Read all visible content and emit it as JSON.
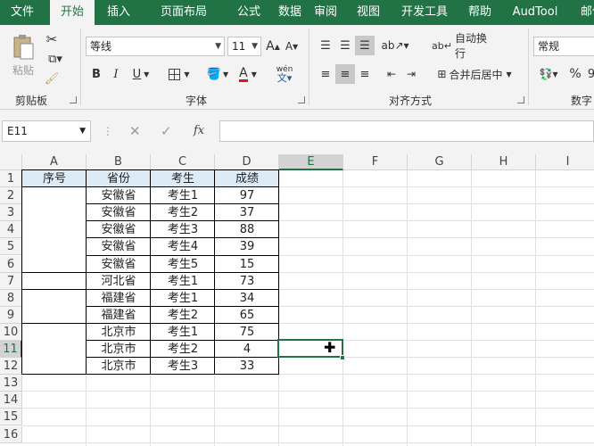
{
  "tabs": [
    "文件",
    "开始",
    "插入",
    "页面布局",
    "公式",
    "数据",
    "审阅",
    "视图",
    "开发工具",
    "帮助",
    "AudTool",
    "邮件"
  ],
  "active_tab": "开始",
  "ribbon": {
    "clipboard": {
      "paste_label": "粘贴",
      "group_label": "剪贴板"
    },
    "font": {
      "font_name": "等线",
      "font_size": "11",
      "bold": "B",
      "italic": "I",
      "underline": "U",
      "grow": "A",
      "shrink": "A",
      "phonetic": "wén",
      "font_color_letter": "A",
      "group_label": "字体"
    },
    "alignment": {
      "wrap_text": "自动换行",
      "merge_center": "合并后居中",
      "group_label": "对齐方式"
    },
    "number": {
      "format": "常规",
      "percent": "%",
      "comma": "9",
      "group_label": "数字"
    }
  },
  "formula_bar": {
    "name_box": "E11",
    "fx": "fx",
    "content": ""
  },
  "columns": [
    "A",
    "B",
    "C",
    "D",
    "E",
    "F",
    "G",
    "H",
    "I"
  ],
  "rows": [
    "1",
    "2",
    "3",
    "4",
    "5",
    "6",
    "7",
    "8",
    "9",
    "10",
    "11",
    "12",
    "13",
    "14",
    "15",
    "16"
  ],
  "active_cell": {
    "column": "E",
    "row": "11"
  },
  "table": {
    "headers": [
      "序号",
      "省份",
      "考生",
      "成绩"
    ],
    "rows": [
      [
        "",
        "安徽省",
        "考生1",
        "97"
      ],
      [
        "",
        "安徽省",
        "考生2",
        "37"
      ],
      [
        "",
        "安徽省",
        "考生3",
        "88"
      ],
      [
        "",
        "安徽省",
        "考生4",
        "39"
      ],
      [
        "",
        "安徽省",
        "考生5",
        "15"
      ],
      [
        "",
        "河北省",
        "考生1",
        "73"
      ],
      [
        "",
        "福建省",
        "考生1",
        "34"
      ],
      [
        "",
        "福建省",
        "考生2",
        "65"
      ],
      [
        "",
        "北京市",
        "考生1",
        "75"
      ],
      [
        "",
        "北京市",
        "考生2",
        "4"
      ],
      [
        "",
        "北京市",
        "考生3",
        "33"
      ]
    ]
  },
  "colors": {
    "accent": "#217346",
    "header_fill": "#ddebf7",
    "font_color_bar": "#e81123"
  }
}
